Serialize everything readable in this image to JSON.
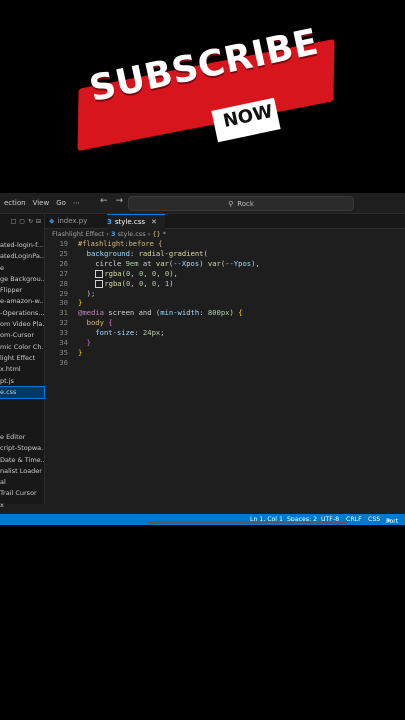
{
  "banner": {
    "subscribe": "SUBSCRIBE",
    "now": "NOW"
  },
  "titlebar": {
    "menu": [
      "ection",
      "View",
      "Go",
      "⋯"
    ],
    "search": "Rock"
  },
  "sidebar": {
    "items": [
      "ated-login-f...",
      "atedLoginPa...",
      "e",
      "ge Backgrou...",
      " Flipper",
      "e-amazon-w...",
      "-Operations...",
      "om Video Pla...",
      "om-Cursor",
      "mic Color Ch...",
      "light Effect",
      "x.html",
      "pt.js",
      "e.css"
    ],
    "items2": [
      "e Editor",
      "cript-Stopwa...",
      "Date & Time...",
      "nalist Loader",
      "al",
      " Trail Cursor",
      "x"
    ]
  },
  "tabs": [
    {
      "label": "index.py"
    },
    {
      "label": "style.css"
    }
  ],
  "breadcrumb": {
    "folder": "Flashlight Effect",
    "file": "style.css",
    "symbol": "*"
  },
  "sticky": {
    "ln": "19",
    "text": "#flashlight:before {"
  },
  "code": {
    "l25": "25",
    "l26": "26",
    "l27": "27",
    "l28": "28",
    "l29": "29",
    "l30": "30",
    "l31": "31",
    "l32": "32",
    "l33": "33",
    "l34": "34",
    "l35": "35",
    "l36": "36"
  },
  "status": {
    "ln": "Ln 1, Col 1",
    "spaces": "Spaces: 2",
    "enc": "UTF-8",
    "eol": "CRLF",
    "lang": "CSS",
    "port": "Port"
  }
}
